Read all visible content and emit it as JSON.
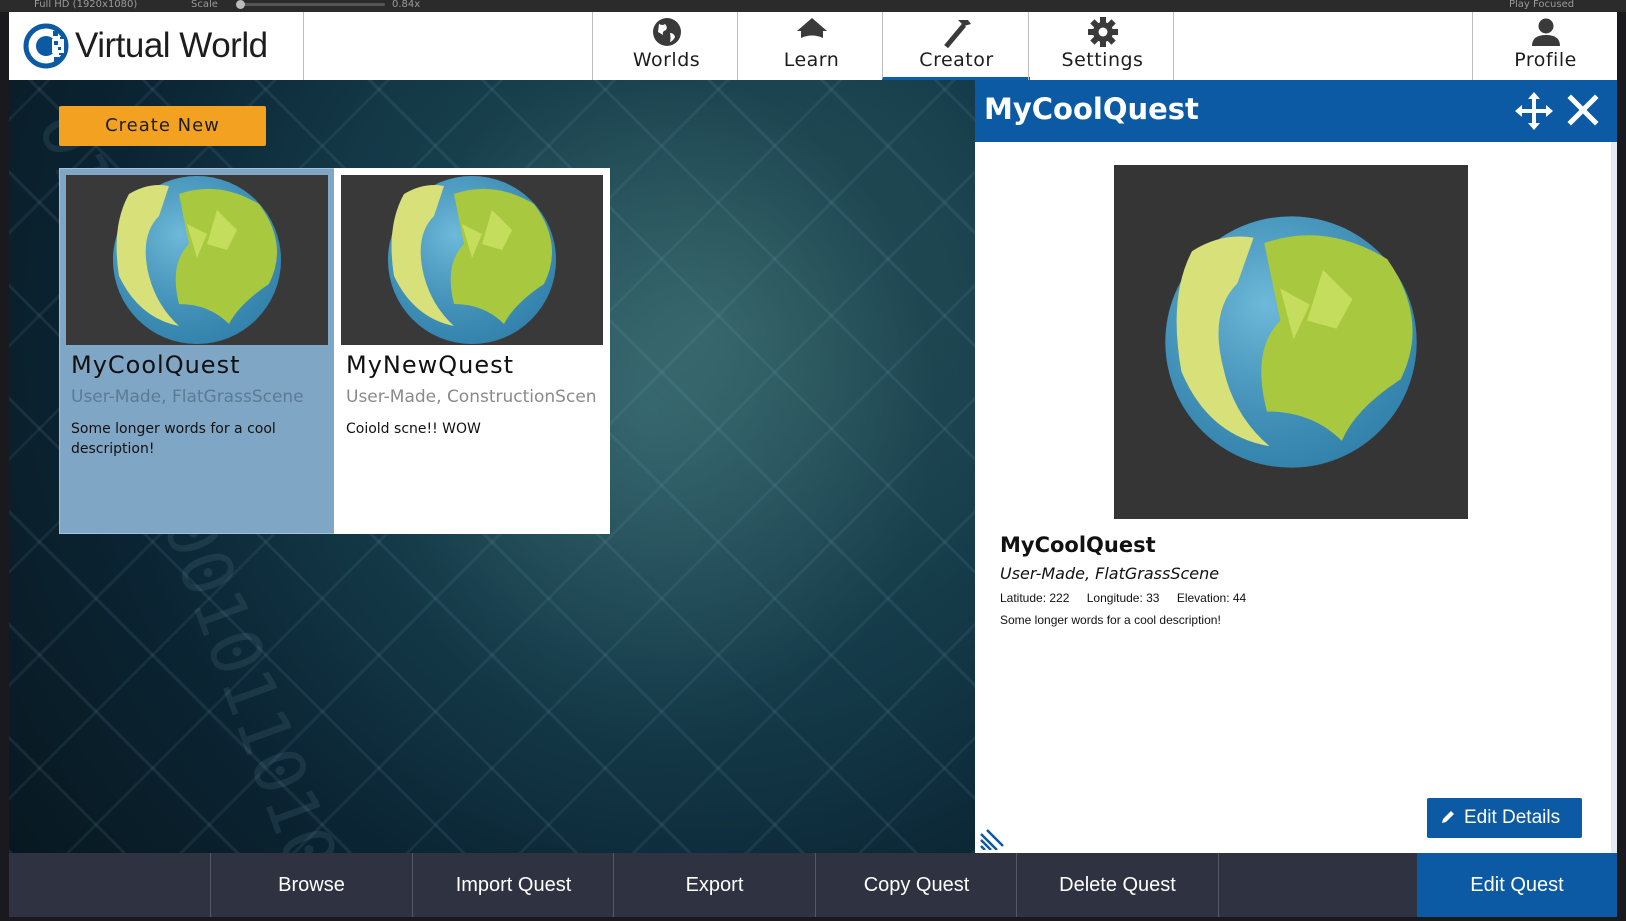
{
  "editor_toolbar": {
    "resolution": "Full HD (1920x1080)",
    "scale_label": "Scale",
    "scale_value": "0.84x",
    "play_mode": "Play Focused"
  },
  "app": {
    "logo_text": "Virtual World"
  },
  "nav": {
    "items": [
      {
        "label": "Worlds",
        "icon": "globe-icon"
      },
      {
        "label": "Learn",
        "icon": "home-icon"
      },
      {
        "label": "Creator",
        "icon": "hammer-icon",
        "active": true
      },
      {
        "label": "Settings",
        "icon": "gear-icon"
      },
      {
        "label": "Profile",
        "icon": "user-icon"
      }
    ]
  },
  "main": {
    "create_new_label": "Create New",
    "quests": [
      {
        "title": "MyCoolQuest",
        "subtitle": "User-Made, FlatGrassScene",
        "description": "Some longer words for a cool description!",
        "selected": true
      },
      {
        "title": "MyNewQuest",
        "subtitle": "User-Made, ConstructionScen",
        "description": "Coiold scne!! WOW",
        "selected": false
      }
    ]
  },
  "detail_panel": {
    "header_title": "MyCoolQuest",
    "title": "MyCoolQuest",
    "subtitle": "User-Made, FlatGrassScene",
    "latitude": "Latitude: 222",
    "longitude": "Longitude: 33",
    "elevation": "Elevation: 44",
    "description": "Some longer words for a cool description!",
    "edit_details_label": "Edit Details"
  },
  "bottom_bar": {
    "browse": "Browse",
    "import": "Import Quest",
    "export": "Export",
    "copy": "Copy Quest",
    "delete": "Delete Quest",
    "edit": "Edit Quest"
  },
  "colors": {
    "accent_blue": "#0b5aa3",
    "create_orange": "#f2a220",
    "selected_card": "#7fa6c5",
    "bottom_bar": "#2f3240"
  }
}
